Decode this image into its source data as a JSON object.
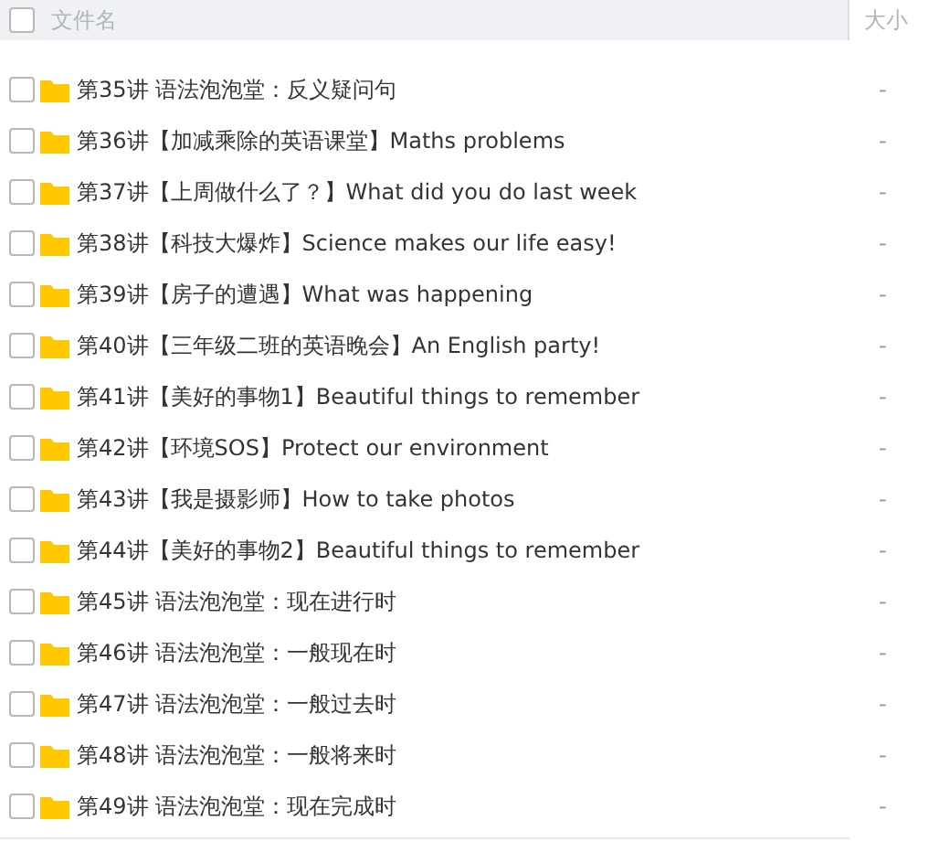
{
  "header": {
    "select_all_checked": false,
    "name_column": "文件名",
    "size_column": "大小"
  },
  "rows": [
    {
      "name": "第35讲 语法泡泡堂：反义疑问句",
      "size": "-",
      "checked": false
    },
    {
      "name": "第36讲【加减乘除的英语课堂】Maths problems",
      "size": "-",
      "checked": false
    },
    {
      "name": "第37讲【上周做什么了？】What did you do last week",
      "size": "-",
      "checked": false
    },
    {
      "name": "第38讲【科技大爆炸】Science makes our life easy!",
      "size": "-",
      "checked": false
    },
    {
      "name": "第39讲【房子的遭遇】What was happening",
      "size": "-",
      "checked": false
    },
    {
      "name": "第40讲【三年级二班的英语晚会】An English party!",
      "size": "-",
      "checked": false
    },
    {
      "name": "第41讲【美好的事物1】Beautiful things to remember",
      "size": "-",
      "checked": false
    },
    {
      "name": "第42讲【环境SOS】Protect our environment",
      "size": "-",
      "checked": false
    },
    {
      "name": "第43讲【我是摄影师】How to take photos",
      "size": "-",
      "checked": false
    },
    {
      "name": "第44讲【美好的事物2】Beautiful things to remember",
      "size": "-",
      "checked": false
    },
    {
      "name": "第45讲 语法泡泡堂：现在进行时",
      "size": "-",
      "checked": false
    },
    {
      "name": "第46讲 语法泡泡堂：一般现在时",
      "size": "-",
      "checked": false
    },
    {
      "name": "第47讲 语法泡泡堂：一般过去时",
      "size": "-",
      "checked": false
    },
    {
      "name": "第48讲 语法泡泡堂：一般将来时",
      "size": "-",
      "checked": false
    },
    {
      "name": "第49讲 语法泡泡堂：现在完成时",
      "size": "-",
      "checked": false
    }
  ]
}
